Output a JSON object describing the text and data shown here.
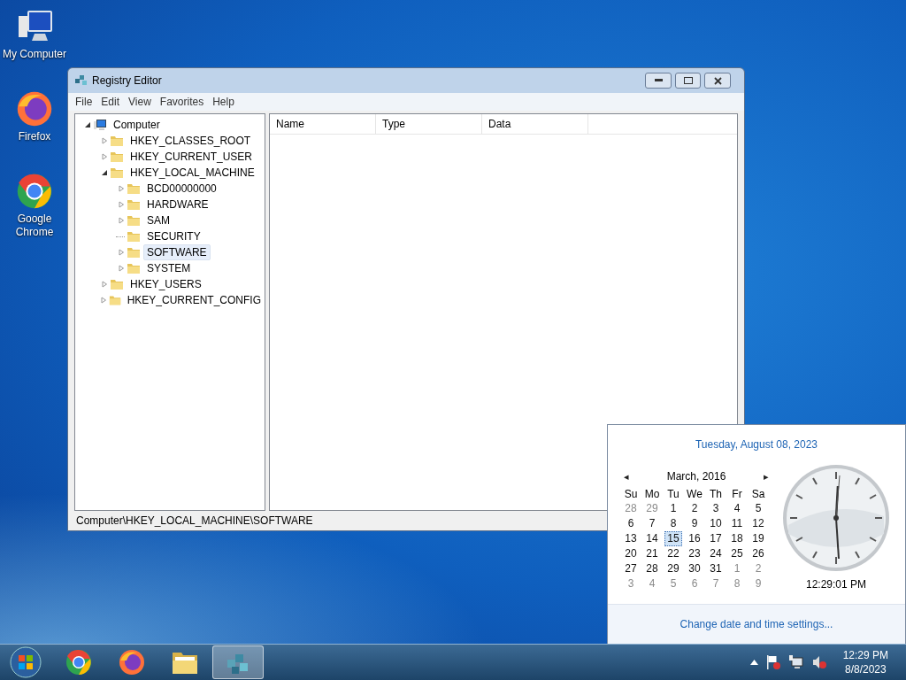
{
  "desktop_icons": [
    {
      "kind": "computer",
      "label": "My Computer"
    },
    {
      "kind": "firefox",
      "label": "Firefox"
    },
    {
      "kind": "chrome",
      "label": "Google Chrome"
    }
  ],
  "window": {
    "title": "Registry Editor",
    "menu": [
      "File",
      "Edit",
      "View",
      "Favorites",
      "Help"
    ],
    "tree": {
      "label": "Computer",
      "kind": "branch",
      "expanded": true,
      "selected": false,
      "children": [
        {
          "label": "HKEY_CLASSES_ROOT",
          "kind": "branch",
          "expanded": false,
          "selected": false
        },
        {
          "label": "HKEY_CURRENT_USER",
          "kind": "branch",
          "expanded": false,
          "selected": false
        },
        {
          "label": "HKEY_LOCAL_MACHINE",
          "kind": "branch",
          "expanded": true,
          "selected": false,
          "children": [
            {
              "label": "BCD00000000",
              "kind": "branch",
              "expanded": false,
              "selected": false
            },
            {
              "label": "HARDWARE",
              "kind": "branch",
              "expanded": false,
              "selected": false
            },
            {
              "label": "SAM",
              "kind": "branch",
              "expanded": false,
              "selected": false
            },
            {
              "label": "SECURITY",
              "kind": "leaf",
              "selected": false
            },
            {
              "label": "SOFTWARE",
              "kind": "branch",
              "expanded": false,
              "selected": true
            },
            {
              "label": "SYSTEM",
              "kind": "branch",
              "expanded": false,
              "selected": false
            }
          ]
        },
        {
          "label": "HKEY_USERS",
          "kind": "branch",
          "expanded": false,
          "selected": false
        },
        {
          "label": "HKEY_CURRENT_CONFIG",
          "kind": "branch",
          "expanded": false,
          "selected": false
        }
      ]
    },
    "columns": [
      "Name",
      "Type",
      "Data"
    ],
    "status_bar": "Computer\\HKEY_LOCAL_MACHINE\\SOFTWARE"
  },
  "calendar_flyout": {
    "date_heading": "Tuesday, August 08, 2023",
    "prev": "◂",
    "month_label": "March, 2016",
    "next": "▸",
    "weekdays": [
      "Su",
      "Mo",
      "Tu",
      "We",
      "Th",
      "Fr",
      "Sa"
    ],
    "weeks": [
      [
        {
          "day": "28",
          "muted": true,
          "selected": false
        },
        {
          "day": "29",
          "muted": true,
          "selected": false
        },
        {
          "day": "1",
          "muted": false,
          "selected": false
        },
        {
          "day": "2",
          "muted": false,
          "selected": false
        },
        {
          "day": "3",
          "muted": false,
          "selected": false
        },
        {
          "day": "4",
          "muted": false,
          "selected": false
        },
        {
          "day": "5",
          "muted": false,
          "selected": false
        }
      ],
      [
        {
          "day": "6",
          "muted": false,
          "selected": false
        },
        {
          "day": "7",
          "muted": false,
          "selected": false
        },
        {
          "day": "8",
          "muted": false,
          "selected": false
        },
        {
          "day": "9",
          "muted": false,
          "selected": false
        },
        {
          "day": "10",
          "muted": false,
          "selected": false
        },
        {
          "day": "11",
          "muted": false,
          "selected": false
        },
        {
          "day": "12",
          "muted": false,
          "selected": false
        }
      ],
      [
        {
          "day": "13",
          "muted": false,
          "selected": false
        },
        {
          "day": "14",
          "muted": false,
          "selected": false
        },
        {
          "day": "15",
          "muted": false,
          "selected": true
        },
        {
          "day": "16",
          "muted": false,
          "selected": false
        },
        {
          "day": "17",
          "muted": false,
          "selected": false
        },
        {
          "day": "18",
          "muted": false,
          "selected": false
        },
        {
          "day": "19",
          "muted": false,
          "selected": false
        }
      ],
      [
        {
          "day": "20",
          "muted": false,
          "selected": false
        },
        {
          "day": "21",
          "muted": false,
          "selected": false
        },
        {
          "day": "22",
          "muted": false,
          "selected": false
        },
        {
          "day": "23",
          "muted": false,
          "selected": false
        },
        {
          "day": "24",
          "muted": false,
          "selected": false
        },
        {
          "day": "25",
          "muted": false,
          "selected": false
        },
        {
          "day": "26",
          "muted": false,
          "selected": false
        }
      ],
      [
        {
          "day": "27",
          "muted": false,
          "selected": false
        },
        {
          "day": "28",
          "muted": false,
          "selected": false
        },
        {
          "day": "29",
          "muted": false,
          "selected": false
        },
        {
          "day": "30",
          "muted": false,
          "selected": false
        },
        {
          "day": "31",
          "muted": false,
          "selected": false
        },
        {
          "day": "1",
          "muted": true,
          "selected": false
        },
        {
          "day": "2",
          "muted": true,
          "selected": false
        }
      ],
      [
        {
          "day": "3",
          "muted": true,
          "selected": false
        },
        {
          "day": "4",
          "muted": true,
          "selected": false
        },
        {
          "day": "5",
          "muted": true,
          "selected": false
        },
        {
          "day": "6",
          "muted": true,
          "selected": false
        },
        {
          "day": "7",
          "muted": true,
          "selected": false
        },
        {
          "day": "8",
          "muted": true,
          "selected": false
        },
        {
          "day": "9",
          "muted": true,
          "selected": false
        }
      ]
    ],
    "time": "12:29:01 PM",
    "link": "Change date and time settings..."
  },
  "taskbar": {
    "items": [
      {
        "kind": "chrome",
        "selected": false
      },
      {
        "kind": "firefox",
        "selected": false
      },
      {
        "kind": "folder",
        "selected": false
      },
      {
        "kind": "registry",
        "selected": true
      }
    ],
    "clock": {
      "time": "12:29 PM",
      "date": "8/8/2023"
    }
  }
}
